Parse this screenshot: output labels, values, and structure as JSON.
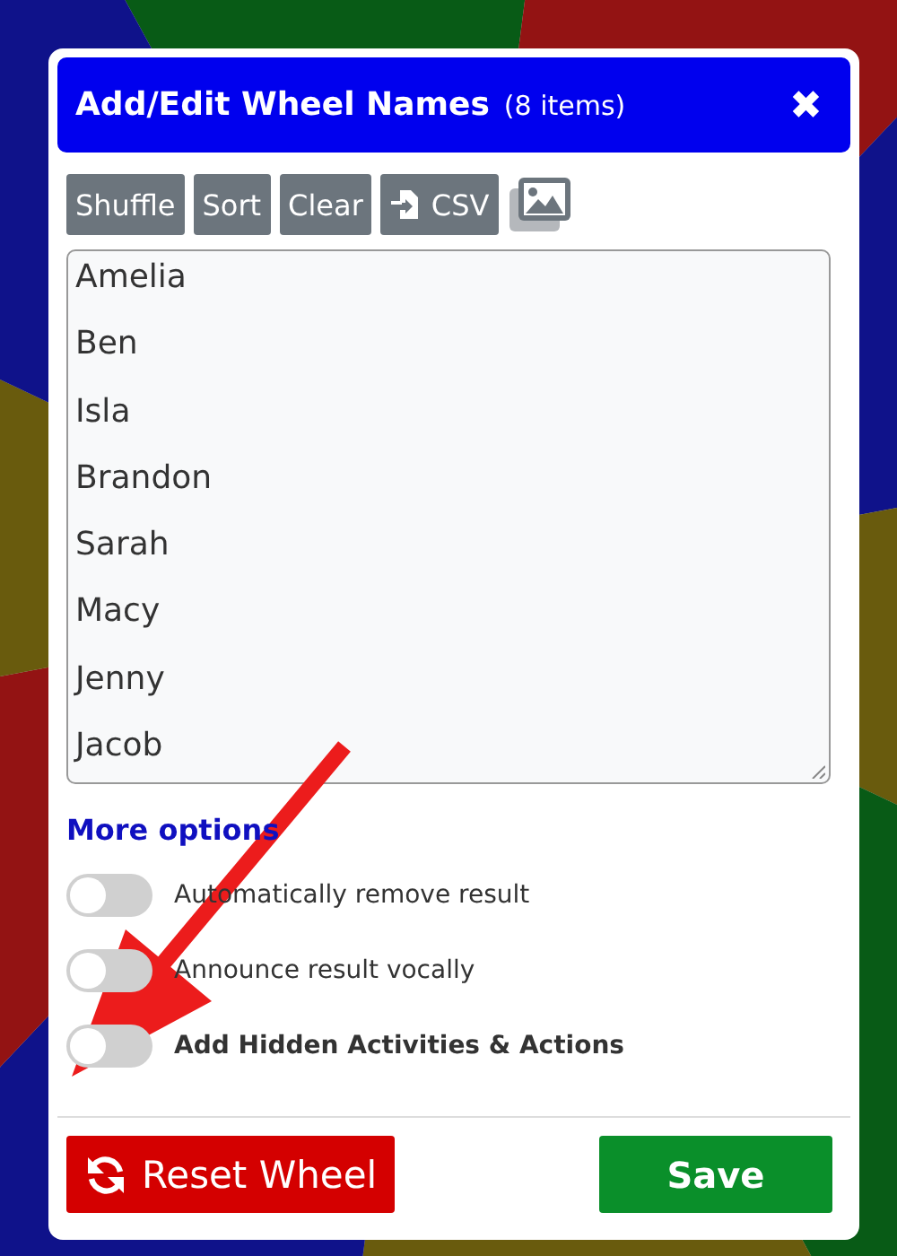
{
  "dialog": {
    "title": "Add/Edit Wheel Names",
    "count": "(8 items)",
    "close": "✖"
  },
  "toolbar": [
    {
      "label": "Shuffle",
      "kind": "text"
    },
    {
      "label": "Sort",
      "kind": "text"
    },
    {
      "label": "Clear",
      "kind": "text"
    },
    {
      "label": "CSV",
      "kind": "file"
    },
    {
      "kind": "image"
    }
  ],
  "names": [
    "Amelia",
    "Ben",
    "Isla",
    "Brandon",
    "Sarah",
    "Macy",
    "Jenny",
    "Jacob"
  ],
  "more_options": "More options",
  "options": [
    {
      "label": "Automatically remove result",
      "on": false,
      "bold": false
    },
    {
      "label": "Announce result vocally",
      "on": false,
      "bold": false
    },
    {
      "label": "Add Hidden Activities & Actions",
      "on": false,
      "bold": true
    }
  ],
  "footer": {
    "reset": "Reset Wheel",
    "save": "Save"
  }
}
